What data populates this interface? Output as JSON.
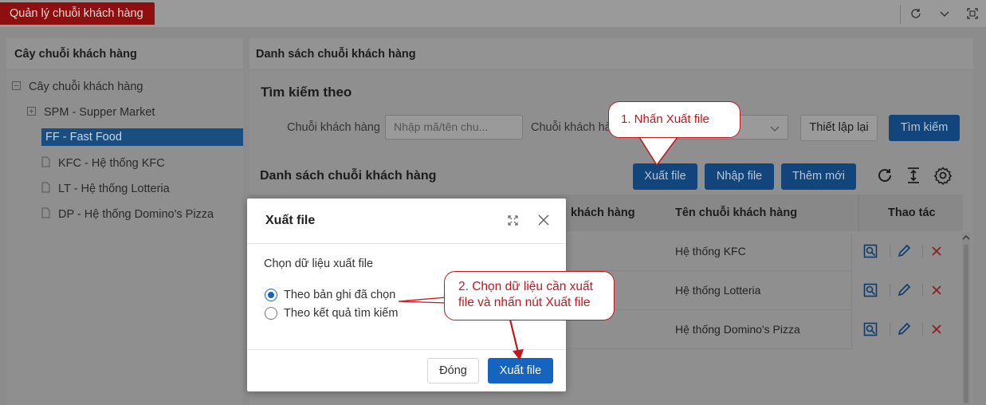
{
  "app_tab": "Quản lý chuỗi khách hàng",
  "toolbar": {
    "icons": [
      "refresh-icon",
      "chevron-down-icon",
      "fullscreen-icon"
    ]
  },
  "left": {
    "header": "Cây chuỗi khách hàng",
    "tree": [
      {
        "label": "Cây chuỗi khách hàng",
        "icon": "collapse-icon"
      },
      {
        "label": "SPM - Supper Market",
        "icon": "expand-icon"
      },
      {
        "label": "FF - Fast Food",
        "selected": true
      },
      {
        "label": "KFC - Hệ thống KFC",
        "icon": "file-icon"
      },
      {
        "label": "LT - Hệ thống Lotteria",
        "icon": "file-icon"
      },
      {
        "label": "DP - Hệ thống Domino's Pizza",
        "icon": "file-icon"
      }
    ]
  },
  "right": {
    "header": "Danh sách chuỗi khách hàng",
    "search": {
      "title": "Tìm kiếm theo",
      "chain_label": "Chuỗi khách hàng",
      "chain_placeholder": "Nhập mã/tên chu...",
      "chain2_label": "Chuỗi khách hà",
      "reset_button": "Thiết lập lại",
      "search_button": "Tìm kiếm"
    },
    "list": {
      "title": "Danh sách chuỗi khách hàng",
      "export_button": "Xuất file",
      "import_button": "Nhập file",
      "add_button": "Thêm mới",
      "columns": [
        "khách hàng",
        "Tên chuỗi khách hàng",
        "Thao tác"
      ],
      "rows": [
        {
          "name": "Hệ thống KFC"
        },
        {
          "name": "Hệ thống Lotteria"
        },
        {
          "name": "Hệ thống Domino's Pizza"
        }
      ]
    }
  },
  "modal": {
    "title": "Xuất file",
    "prompt": "Chọn dữ liệu xuất file",
    "options": [
      {
        "label": "Theo bản ghi đã chọn",
        "checked": true
      },
      {
        "label": "Theo kết quả tìm kiếm",
        "checked": false
      }
    ],
    "close_button": "Đóng",
    "export_button": "Xuất file"
  },
  "callouts": {
    "step1": "1. Nhấn Xuất file",
    "step2_line1": "2. Chọn dữ liệu cần xuất",
    "step2_line2": "file và nhấn nút Xuất file"
  },
  "colors": {
    "accent": "#1565c0",
    "callout": "#c4171d",
    "app_tab": "#8e0f0f"
  }
}
